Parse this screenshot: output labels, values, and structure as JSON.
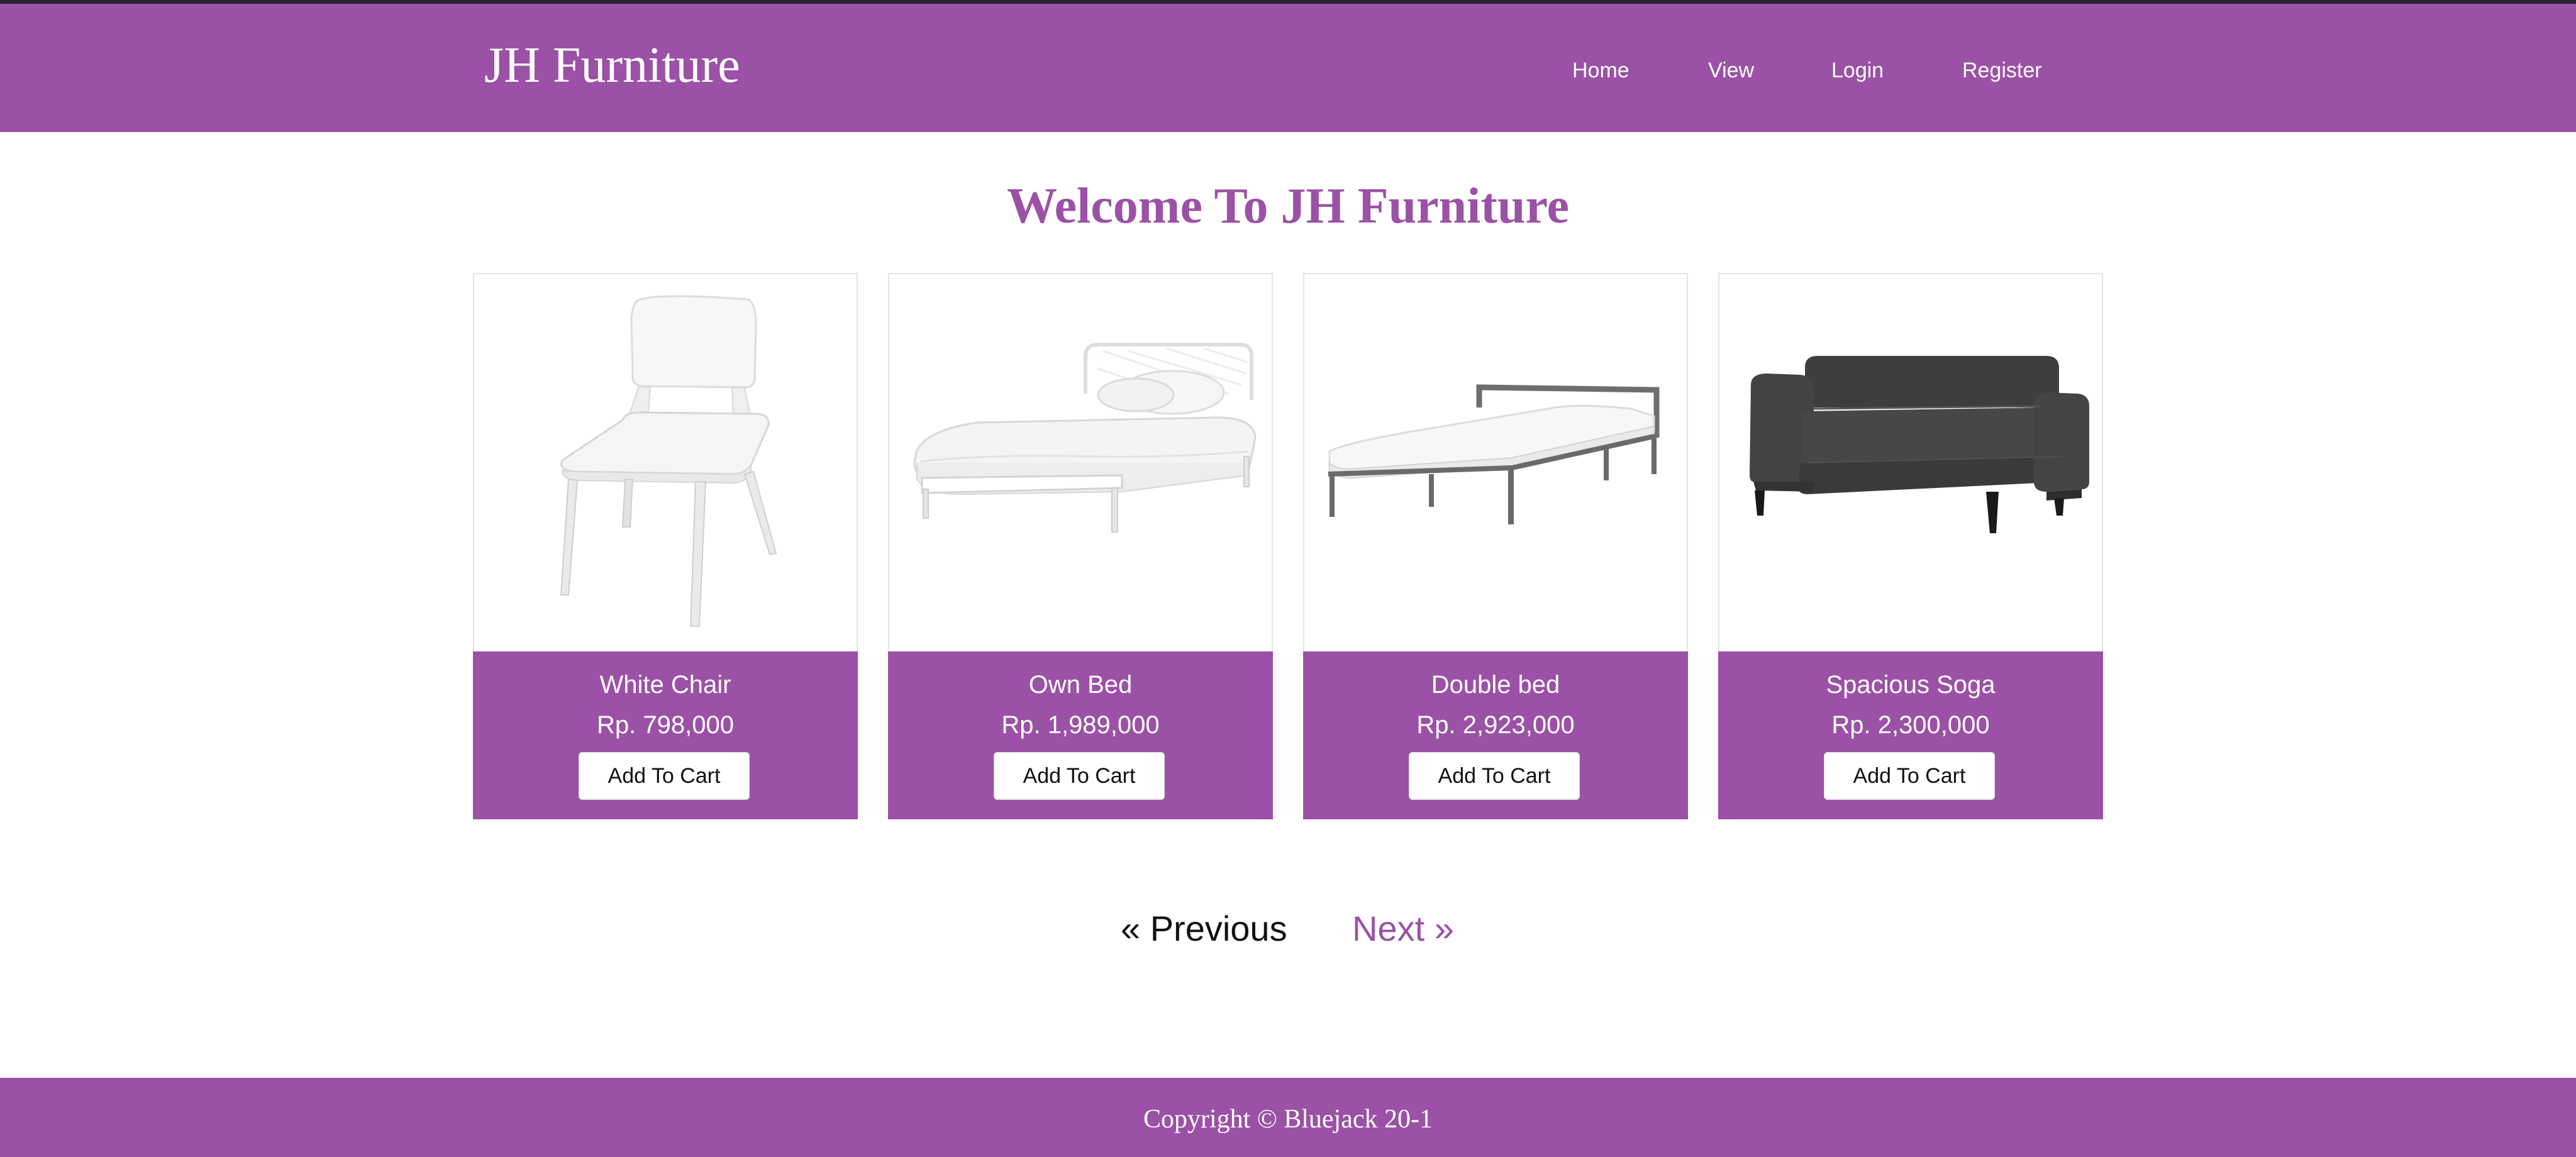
{
  "brand": {
    "title": "JH Furniture"
  },
  "nav": {
    "items": [
      {
        "label": "Home"
      },
      {
        "label": "View"
      },
      {
        "label": "Login"
      },
      {
        "label": "Register"
      }
    ]
  },
  "main": {
    "heading": "Welcome To JH Furniture",
    "products": [
      {
        "name": "White Chair",
        "price": "Rp. 798,000",
        "button": "Add To Cart",
        "image": "white-chair"
      },
      {
        "name": "Own Bed",
        "price": "Rp. 1,989,000",
        "button": "Add To Cart",
        "image": "white-bed"
      },
      {
        "name": "Double bed",
        "price": "Rp. 2,923,000",
        "button": "Add To Cart",
        "image": "double-bed-frame"
      },
      {
        "name": "Spacious Soga",
        "price": "Rp. 2,300,000",
        "button": "Add To Cart",
        "image": "dark-gray-sofa"
      }
    ]
  },
  "pagination": {
    "previous": "« Previous",
    "next": "Next »"
  },
  "footer": {
    "copyright": "Copyright © Bluejack 20-1"
  },
  "colors": {
    "accent": "#9b51a6",
    "text_dark": "#111111",
    "white": "#ffffff"
  }
}
